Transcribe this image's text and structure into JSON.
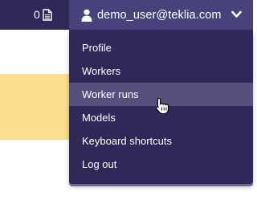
{
  "navbar": {
    "document_count": "0",
    "user_email": "demo_user@teklia.com"
  },
  "user_menu": {
    "items": [
      {
        "label": "Profile"
      },
      {
        "label": "Workers"
      },
      {
        "label": "Worker runs"
      },
      {
        "label": "Models"
      },
      {
        "label": "Keyboard shortcuts"
      },
      {
        "label": "Log out"
      }
    ],
    "hovered_item": "Worker runs"
  },
  "colors": {
    "navbar_bg": "#2e2958",
    "user_toggle_bg": "#48427a",
    "menu_hover_bg": "#56507f",
    "highlight_band": "#fbdf8e",
    "text": "#ffffff"
  },
  "icons": [
    "document-icon",
    "user-icon",
    "chevron-down-icon",
    "hand-pointer-cursor-icon"
  ]
}
